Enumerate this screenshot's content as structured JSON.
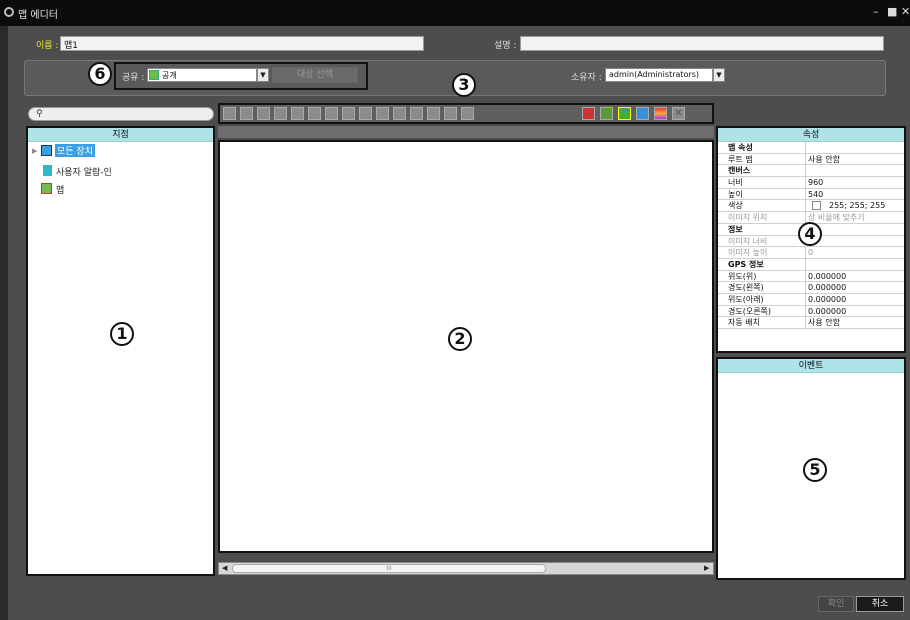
{
  "window": {
    "title": "맵 에디터",
    "minimize": "–",
    "maximize": "■",
    "close": "✕"
  },
  "form": {
    "name_label": "이름 :",
    "name_value": "맵1",
    "desc_label": "설명 :",
    "desc_value": ""
  },
  "share": {
    "label": "공유 :",
    "value": "공개",
    "target_button": "대상 선택"
  },
  "owner": {
    "label": "소유자 :",
    "value": "admin(Administrators)"
  },
  "search": {
    "placeholder": ""
  },
  "site_panel": {
    "header": "지점",
    "items": [
      {
        "label": "모든 장치",
        "icon": "device-list-icon",
        "selected": true
      },
      {
        "label": "사용자 알람-인",
        "icon": "alarm-in-icon"
      },
      {
        "label": "맵",
        "icon": "map-icon"
      }
    ]
  },
  "properties": {
    "header": "속성",
    "rows": [
      {
        "key": "맵 속성",
        "value": "",
        "type": "cat"
      },
      {
        "key": "루트 맵",
        "value": "사용 안함"
      },
      {
        "key": "캔버스",
        "value": "",
        "type": "cat"
      },
      {
        "key": "너비",
        "value": "960"
      },
      {
        "key": "높이",
        "value": "540"
      },
      {
        "key": "색상",
        "value": "255; 255; 255",
        "swatch": true
      },
      {
        "key": "이미지 위치",
        "value": "상 비율에 맞추기",
        "type": "dis"
      },
      {
        "key": "정보",
        "value": "",
        "type": "cat"
      },
      {
        "key": "이미지 너비",
        "value": "0",
        "type": "dis"
      },
      {
        "key": "이미지 높이",
        "value": "0",
        "type": "dis"
      },
      {
        "key": "GPS 정보",
        "value": "",
        "type": "cat"
      },
      {
        "key": "위도(위)",
        "value": "0.000000"
      },
      {
        "key": "경도(왼쪽)",
        "value": "0.000000"
      },
      {
        "key": "위도(아래)",
        "value": "0.000000"
      },
      {
        "key": "경도(오른쪽)",
        "value": "0.000000"
      },
      {
        "key": "자동 배치",
        "value": "사용 안함"
      }
    ]
  },
  "events": {
    "header": "이벤트"
  },
  "scrollbar": {
    "thumb_grip": "III"
  },
  "buttons": {
    "ok": "확인",
    "cancel": "취소"
  },
  "callouts": [
    "1",
    "2",
    "3",
    "4",
    "5",
    "6"
  ],
  "colors": {
    "header_bg": "#aee3e8",
    "selected_bg": "#3aa0e0",
    "window_bg": "#4d4d4d"
  }
}
